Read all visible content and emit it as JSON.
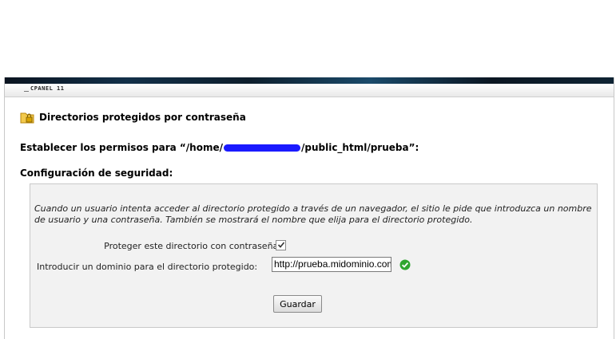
{
  "header": {
    "brand": "CPANEL 11"
  },
  "page": {
    "title": "Directorios protegidos por contraseña",
    "permissions_prefix": "Establecer los permisos para “/home/",
    "permissions_suffix": "/public_html/prueba”:",
    "section_title": "Configuración de seguridad:"
  },
  "panel": {
    "description": "Cuando un usuario intenta acceder al directorio protegido a través de un navegador, el sitio le pide que introduzca un nombre de usuario y una contraseña. También se mostrará el nombre que elija para el directorio protegido.",
    "protect_label": "Proteger este directorio con contraseña:",
    "protect_checked": true,
    "domain_label": "Introducir un dominio para el directorio protegido:",
    "domain_value": "http://prueba.midominio.com",
    "save_label": "Guardar"
  },
  "icons": {
    "title_icon": "folder-lock-icon",
    "valid_icon": "check-circle-icon"
  },
  "colors": {
    "redaction": "#1a1aff",
    "valid": "#2fa52f",
    "panel_bg": "#f2f2f2"
  }
}
